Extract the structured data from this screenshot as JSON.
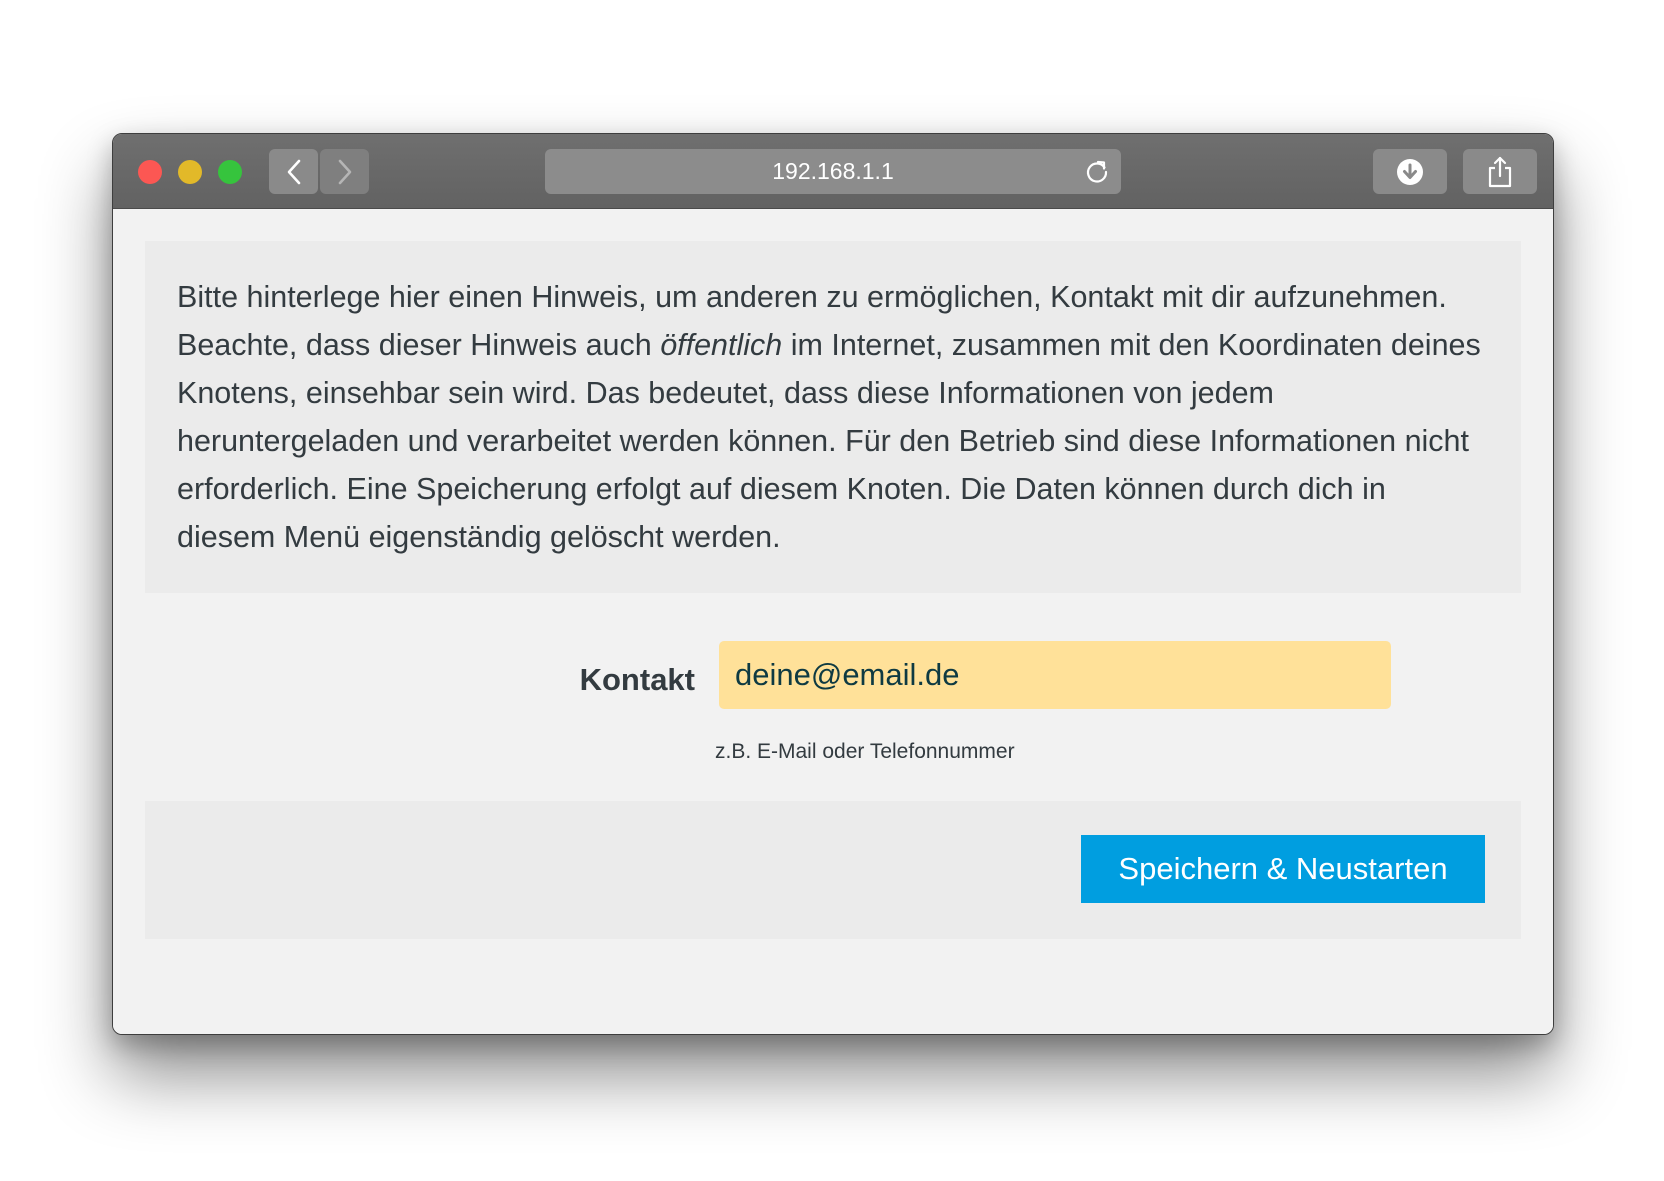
{
  "browser": {
    "url": "192.168.1.1",
    "traffic_lights": {
      "close_color": "#fc5753",
      "minimize_color": "#e2b929",
      "maximize_color": "#36c43d"
    },
    "icons": {
      "back": "chevron-left-icon",
      "forward": "chevron-right-icon",
      "reload": "reload-icon",
      "download": "download-icon",
      "share": "share-icon"
    }
  },
  "notice": {
    "text_before": "Bitte hinterlege hier einen Hinweis, um anderen zu ermöglichen, Kontakt mit dir aufzunehmen. Beachte, dass dieser Hinweis auch ",
    "text_emphasis": "öffentlich",
    "text_after": " im Internet, zusammen mit den Koordinaten deines Knotens, einsehbar sein wird. Das bedeutet, dass diese Informationen von jedem heruntergeladen und verarbeitet werden können. Für den Betrieb sind diese Informationen nicht erforderlich. Eine Speicherung erfolgt auf diesem Knoten. Die Daten können durch dich in diesem Menü eigenständig gelöscht werden."
  },
  "form": {
    "contact_label": "Kontakt",
    "contact_value": "deine@email.de",
    "contact_hint": "z.B. E-Mail oder Telefonnummer"
  },
  "actions": {
    "save_label": "Speichern & Neustarten"
  },
  "colors": {
    "accent": "#009ee0",
    "input_highlight": "#ffe199"
  }
}
